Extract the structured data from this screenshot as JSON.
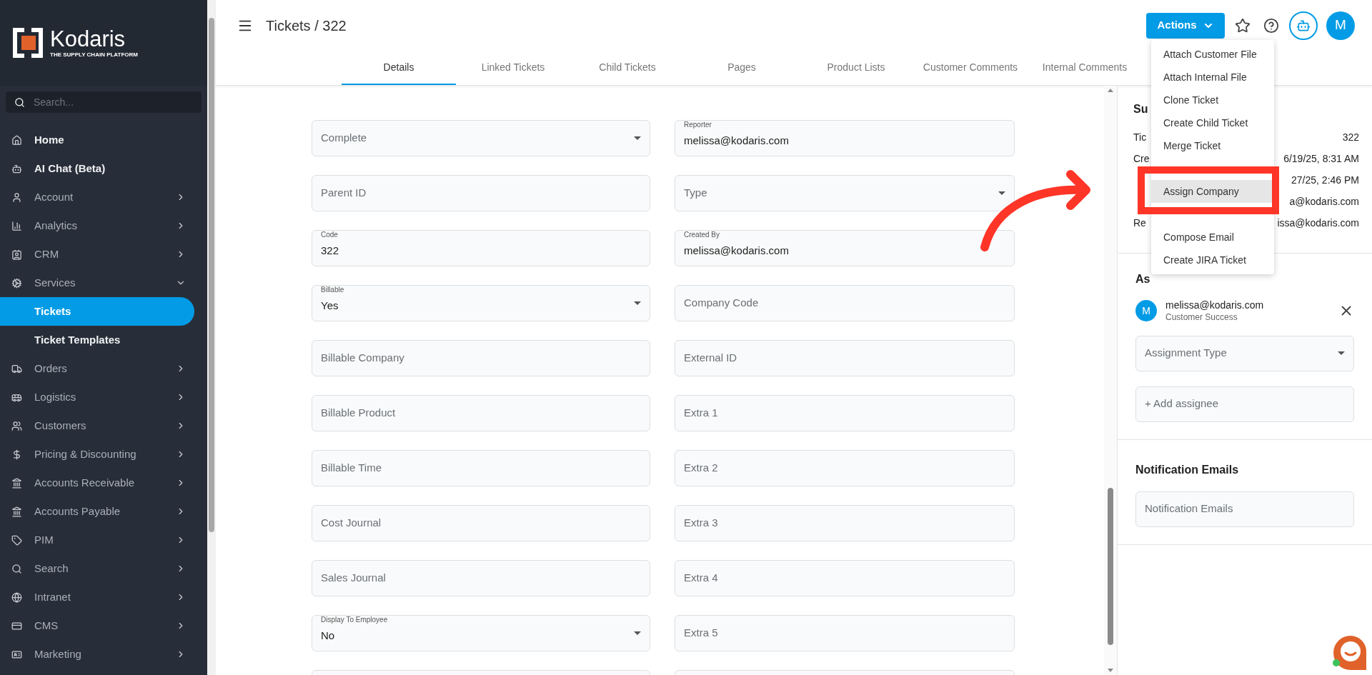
{
  "sidebar": {
    "logo": {
      "name": "Kodaris",
      "tagline": "THE SUPPLY CHAIN PLATFORM"
    },
    "search": {
      "placeholder": "Search..."
    },
    "items": [
      {
        "label": "Home",
        "kind": "link",
        "selected": false
      },
      {
        "label": "AI Chat (Beta)",
        "kind": "link",
        "selected": false
      },
      {
        "label": "Account",
        "kind": "group",
        "expanded": false,
        "selected": false
      },
      {
        "label": "Analytics",
        "kind": "group",
        "expanded": false,
        "selected": false
      },
      {
        "label": "CRM",
        "kind": "group",
        "expanded": false,
        "selected": false
      },
      {
        "label": "Services",
        "kind": "group",
        "expanded": true,
        "selected": false,
        "children": [
          {
            "label": "Tickets",
            "selected": true
          },
          {
            "label": "Ticket Templates",
            "selected": false
          }
        ]
      },
      {
        "label": "Orders",
        "kind": "group",
        "expanded": false,
        "selected": false
      },
      {
        "label": "Logistics",
        "kind": "group",
        "expanded": false,
        "selected": false
      },
      {
        "label": "Customers",
        "kind": "group",
        "expanded": false,
        "selected": false
      },
      {
        "label": "Pricing & Discounting",
        "kind": "group",
        "expanded": false,
        "selected": false
      },
      {
        "label": "Accounts Receivable",
        "kind": "group",
        "expanded": false,
        "selected": false
      },
      {
        "label": "Accounts Payable",
        "kind": "group",
        "expanded": false,
        "selected": false
      },
      {
        "label": "PIM",
        "kind": "group",
        "expanded": false,
        "selected": false
      },
      {
        "label": "Search",
        "kind": "group",
        "expanded": false,
        "selected": false
      },
      {
        "label": "Intranet",
        "kind": "group",
        "expanded": false,
        "selected": false
      },
      {
        "label": "CMS",
        "kind": "group",
        "expanded": false,
        "selected": false
      },
      {
        "label": "Marketing",
        "kind": "group",
        "expanded": false,
        "selected": false
      }
    ]
  },
  "top_bar": {
    "title": "Tickets / 322",
    "actions_button": "Actions",
    "avatar_initial": "M"
  },
  "tabs": [
    {
      "label": "Details",
      "selected": true
    },
    {
      "label": "Linked Tickets",
      "selected": false
    },
    {
      "label": "Child Tickets",
      "selected": false
    },
    {
      "label": "Pages",
      "selected": false
    },
    {
      "label": "Product Lists",
      "selected": false
    },
    {
      "label": "Customer Comments",
      "selected": false
    },
    {
      "label": "Internal Comments",
      "selected": false
    }
  ],
  "actions_menu": [
    {
      "kind": "item",
      "label": "Attach Customer File",
      "selected": false
    },
    {
      "kind": "item",
      "label": "Attach Internal File",
      "selected": false
    },
    {
      "kind": "item",
      "label": "Clone Ticket",
      "selected": false
    },
    {
      "kind": "item",
      "label": "Create Child Ticket",
      "selected": false
    },
    {
      "kind": "item",
      "label": "Merge Ticket",
      "selected": false
    },
    {
      "kind": "covered"
    },
    {
      "kind": "item",
      "label": "Assign Company",
      "selected": true
    },
    {
      "kind": "covered"
    },
    {
      "kind": "item",
      "label": "Compose Email",
      "selected": false
    },
    {
      "kind": "item",
      "label": "Create JIRA Ticket",
      "selected": false
    }
  ],
  "form": {
    "left_column": [
      {
        "kind": "select",
        "placeholder": "Complete"
      },
      {
        "kind": "text",
        "placeholder": "Parent ID"
      },
      {
        "kind": "text",
        "label": "Code",
        "value": "322"
      },
      {
        "kind": "select",
        "label": "Billable",
        "value": "Yes"
      },
      {
        "kind": "text",
        "placeholder": "Billable Company"
      },
      {
        "kind": "text",
        "placeholder": "Billable Product"
      },
      {
        "kind": "text",
        "placeholder": "Billable Time"
      },
      {
        "kind": "text",
        "placeholder": "Cost Journal"
      },
      {
        "kind": "text",
        "placeholder": "Sales Journal"
      },
      {
        "kind": "select",
        "label": "Display To Employee",
        "value": "No"
      }
    ],
    "right_column": [
      {
        "kind": "text",
        "label": "Reporter",
        "value": "melissa@kodaris.com"
      },
      {
        "kind": "select",
        "placeholder": "Type"
      },
      {
        "kind": "text",
        "label": "Created By",
        "value": "melissa@kodaris.com"
      },
      {
        "kind": "text",
        "placeholder": "Company Code"
      },
      {
        "kind": "text",
        "placeholder": "External ID"
      },
      {
        "kind": "text",
        "placeholder": "Extra 1"
      },
      {
        "kind": "text",
        "placeholder": "Extra 2"
      },
      {
        "kind": "text",
        "placeholder": "Extra 3"
      },
      {
        "kind": "text",
        "placeholder": "Extra 4"
      },
      {
        "kind": "text",
        "placeholder": "Extra 5"
      }
    ]
  },
  "summary": {
    "heading": "Su",
    "rows": [
      {
        "label": "Tic",
        "value": "322"
      },
      {
        "label": "Cre",
        "value": "6/19/25, 8:31 AM"
      },
      {
        "value": "27/25, 2:46 PM"
      },
      {
        "value": "a@kodaris.com"
      },
      {
        "label": "Re",
        "value": "issa@kodaris.com"
      }
    ]
  },
  "assignees": {
    "heading": "As",
    "people": [
      {
        "initial": "M",
        "email": "melissa@kodaris.com",
        "team": "Customer Success"
      }
    ],
    "assignment_type": {
      "placeholder": "Assignment Type"
    },
    "add": {
      "placeholder": "+ Add assignee"
    }
  },
  "notifications": {
    "heading": "Notification Emails",
    "field": {
      "placeholder": "Notification Emails"
    }
  }
}
